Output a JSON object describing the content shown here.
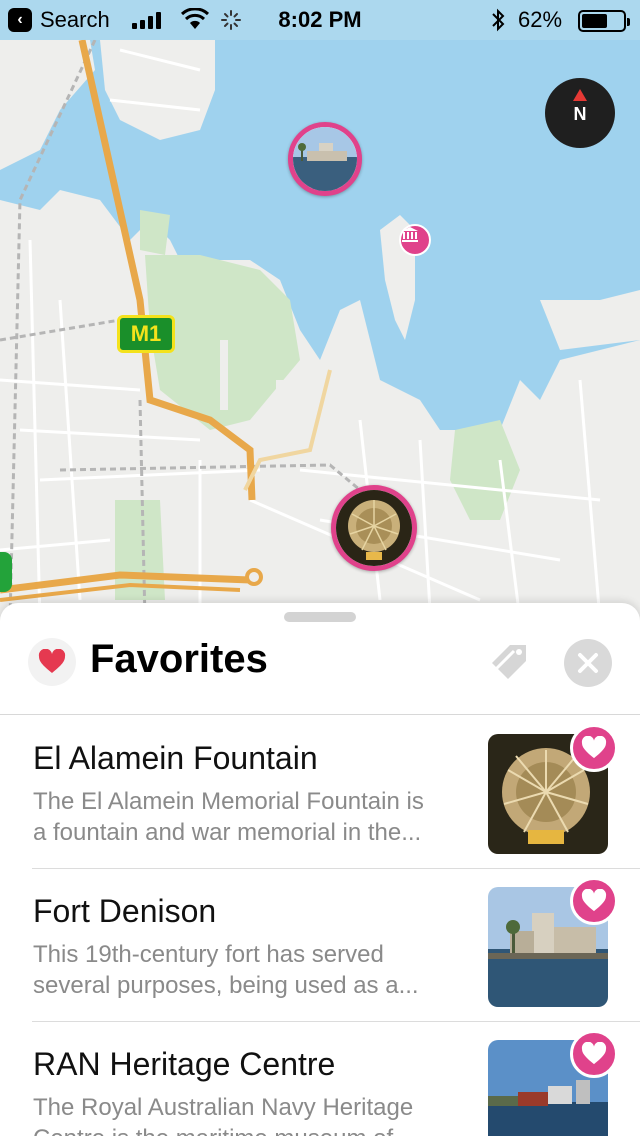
{
  "status_bar": {
    "back_label": "Search",
    "time": "8:02 PM",
    "battery_percent_text": "62%",
    "battery_level": 0.62
  },
  "map": {
    "road_shield": "M1",
    "compass_label": "N",
    "pins": [
      {
        "name": "Fort Denison",
        "icon": "fort-photo"
      },
      {
        "name": "El Alamein Fountain",
        "icon": "fountain-photo"
      },
      {
        "name": "museum",
        "icon": "museum-icon"
      }
    ]
  },
  "panel": {
    "title": "Favorites",
    "title_icon": "heart-icon",
    "tag_icon": "tag-icon",
    "close_icon": "close-icon",
    "items": [
      {
        "title": "El Alamein Fountain",
        "desc_line1": "The El Alamein Memorial Fountain is",
        "desc_line2": "a fountain and war memorial in the...",
        "favorited": true
      },
      {
        "title": "Fort Denison",
        "desc_line1": "This 19th-century fort has served",
        "desc_line2": "several purposes, being used as a...",
        "favorited": true
      },
      {
        "title": "RAN Heritage Centre",
        "desc_line1": "The Royal Australian Navy Heritage",
        "desc_line2": "Centre is the maritime museum of",
        "favorited": true
      }
    ]
  },
  "colors": {
    "accent_pink": "#e0428b",
    "water": "#9fd2ee",
    "road_orange": "#e8a84a"
  }
}
